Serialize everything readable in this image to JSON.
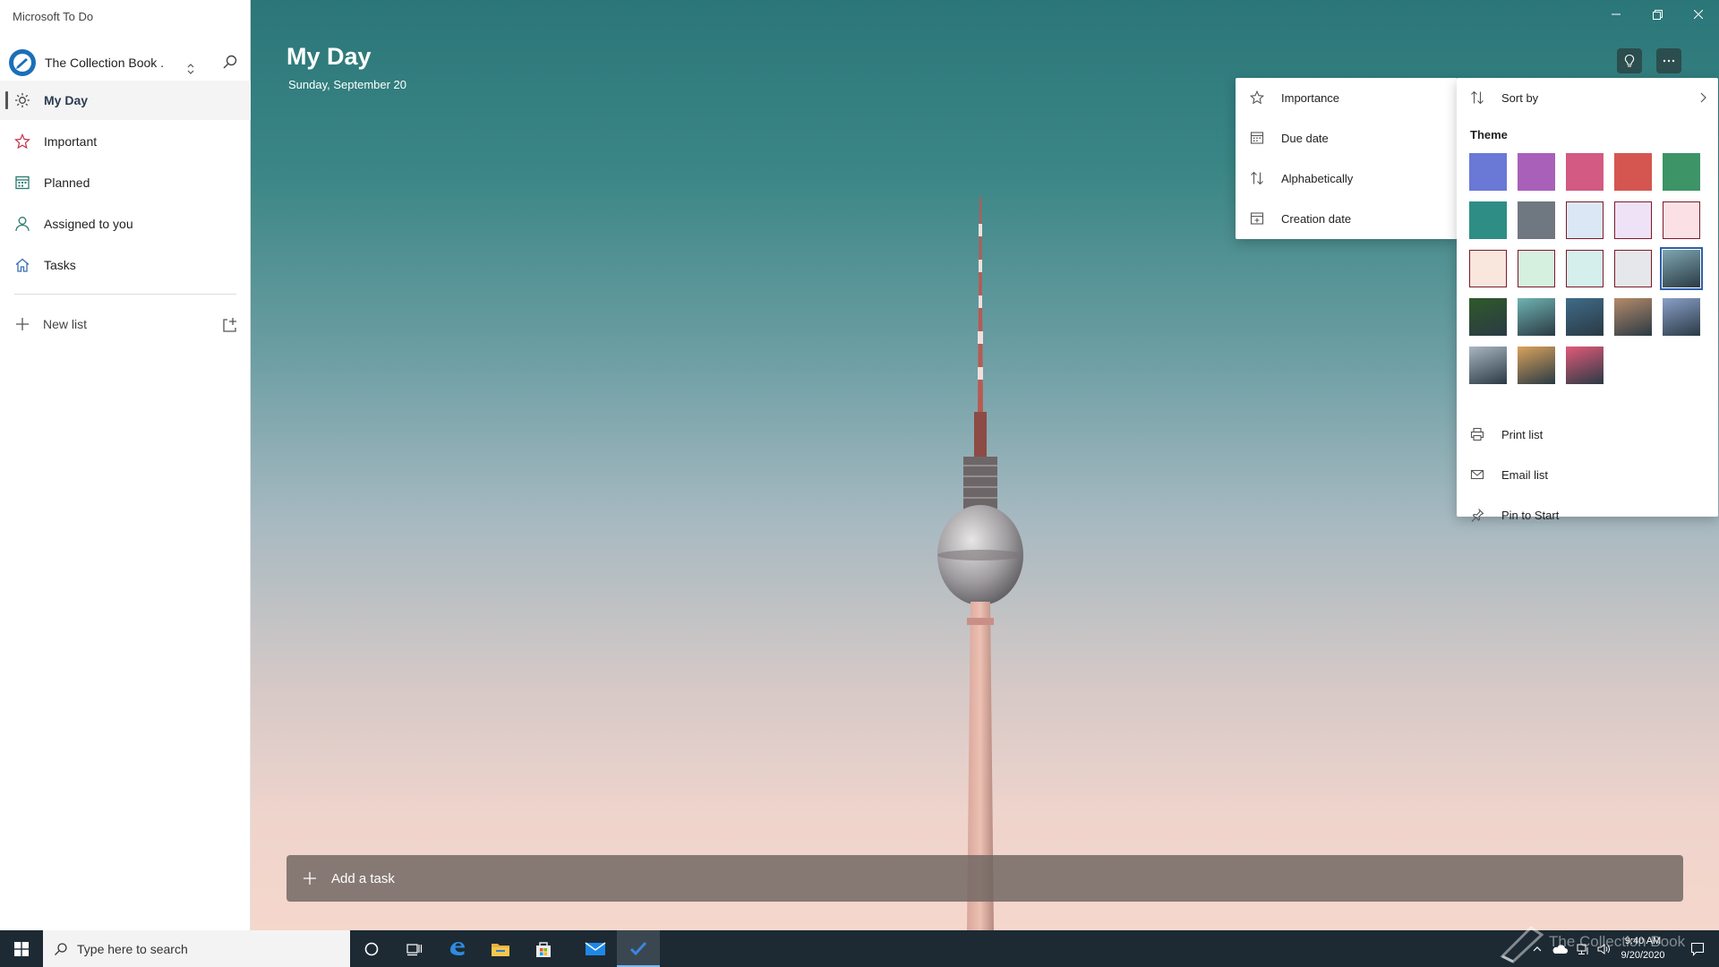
{
  "app": {
    "title": "Microsoft To Do"
  },
  "account": {
    "name": "The Collection Book ."
  },
  "sidebar": {
    "items": [
      {
        "label": "My Day",
        "icon": "sun-icon"
      },
      {
        "label": "Important",
        "icon": "star-icon"
      },
      {
        "label": "Planned",
        "icon": "calendar-icon"
      },
      {
        "label": "Assigned to you",
        "icon": "person-icon"
      },
      {
        "label": "Tasks",
        "icon": "home-icon"
      }
    ],
    "new_list": "New list"
  },
  "main": {
    "title": "My Day",
    "date": "Sunday, September 20",
    "add_task": "Add a task"
  },
  "sort_menu": {
    "items": [
      {
        "label": "Importance",
        "icon": "star-icon"
      },
      {
        "label": "Due date",
        "icon": "calendar-icon"
      },
      {
        "label": "Alphabetically",
        "icon": "sort-icon"
      },
      {
        "label": "Creation date",
        "icon": "calendar-add-icon"
      }
    ]
  },
  "more_menu": {
    "sort_by": "Sort by",
    "theme_label": "Theme",
    "themes": [
      {
        "name": "blue",
        "color": "#6a78d6"
      },
      {
        "name": "purple",
        "color": "#a860b8"
      },
      {
        "name": "pink",
        "color": "#d35a82"
      },
      {
        "name": "red",
        "color": "#d55650"
      },
      {
        "name": "green",
        "color": "#3c9467"
      },
      {
        "name": "teal",
        "color": "#2e8d84"
      },
      {
        "name": "gray",
        "color": "#6f7781"
      },
      {
        "name": "light-blue",
        "color": "#dce7f6"
      },
      {
        "name": "light-purple",
        "color": "#efe2f6"
      },
      {
        "name": "light-pink",
        "color": "#fbe1e6"
      },
      {
        "name": "light-peach",
        "color": "#f9e6dc"
      },
      {
        "name": "light-green",
        "color": "#d6f0e0"
      },
      {
        "name": "light-teal",
        "color": "#d5efec"
      },
      {
        "name": "light-gray",
        "color": "#e5e7ea"
      },
      {
        "name": "photo-tower",
        "color": "#7fa6b0",
        "selected": true
      },
      {
        "name": "photo-leaves",
        "color": "#2f5a2a"
      },
      {
        "name": "photo-beach",
        "color": "#6fb3b1"
      },
      {
        "name": "photo-mountains",
        "color": "#3f6b88"
      },
      {
        "name": "photo-palm",
        "color": "#b58a6a"
      },
      {
        "name": "photo-desert",
        "color": "#8a9fc9"
      },
      {
        "name": "photo-lighthouse",
        "color": "#a9b6c2"
      },
      {
        "name": "photo-poppies",
        "color": "#d9a25c"
      },
      {
        "name": "photo-pink-flower",
        "color": "#e25a7a"
      }
    ],
    "items": [
      {
        "label": "Print list",
        "icon": "printer-icon"
      },
      {
        "label": "Email list",
        "icon": "mail-icon"
      },
      {
        "label": "Pin to Start",
        "icon": "pin-icon"
      }
    ]
  },
  "taskbar": {
    "search_placeholder": "Type here to search",
    "time": "9:40 AM",
    "date": "9/20/2020",
    "watermark": "The Collection Book"
  }
}
